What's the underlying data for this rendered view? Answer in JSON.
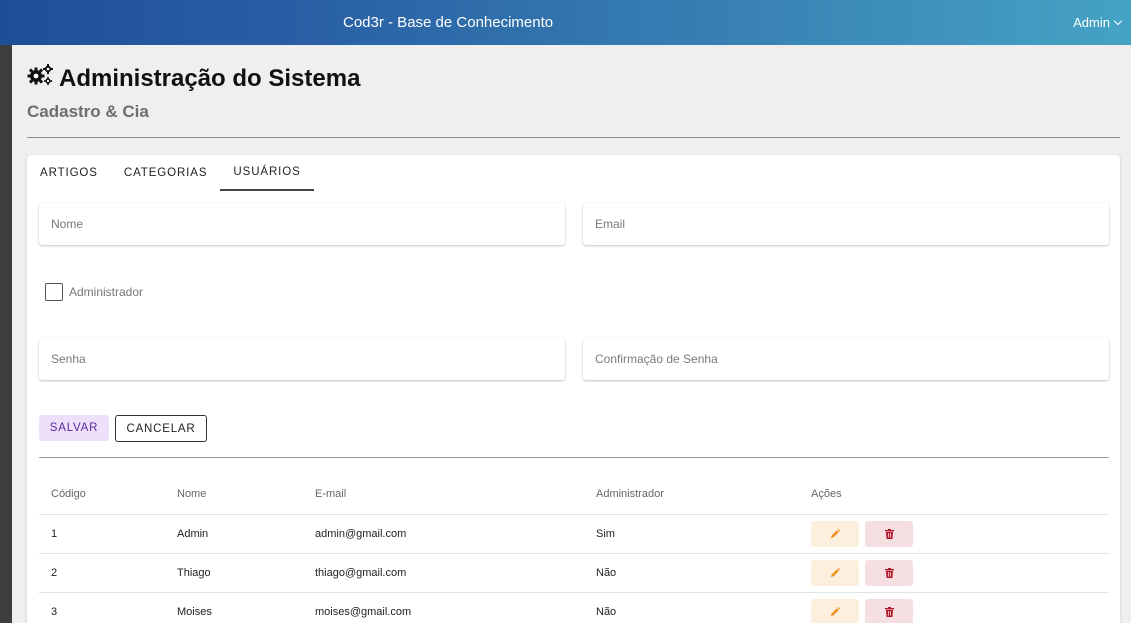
{
  "header": {
    "app_title": "Cod3r - Base de Conhecimento",
    "user_name": "Admin"
  },
  "page": {
    "title": "Administração do Sistema",
    "subtitle": "Cadastro & Cia"
  },
  "tabs": [
    {
      "label": "ARTIGOS"
    },
    {
      "label": "CATEGORIAS"
    },
    {
      "label": "USUÁRIOS"
    }
  ],
  "active_tab": "USUÁRIOS",
  "form": {
    "name_placeholder": "Nome",
    "email_placeholder": "Email",
    "admin_label": "Administrador",
    "password_placeholder": "Senha",
    "confirm_placeholder": "Confirmação de Senha",
    "save_label": "SALVAR",
    "cancel_label": "CANCELAR"
  },
  "table": {
    "headers": [
      "Código",
      "Nome",
      "E-mail",
      "Administrador",
      "Ações"
    ],
    "rows": [
      {
        "id": "1",
        "name": "Admin",
        "email": "admin@gmail.com",
        "admin": "Sim"
      },
      {
        "id": "2",
        "name": "Thiago",
        "email": "thiago@gmail.com",
        "admin": "Não"
      },
      {
        "id": "3",
        "name": "Moises",
        "email": "moises@gmail.com",
        "admin": "Não"
      }
    ]
  },
  "icons": {
    "title_icon": "cogs-icon",
    "edit_icon": "pencil-icon",
    "delete_icon": "trash-icon",
    "user_menu_icon": "chevron-down-icon"
  },
  "colors": {
    "header_start": "#1f4e99",
    "header_end": "#45a3c4",
    "save_bg": "#ede0fb",
    "save_text": "#5a2a9b",
    "edit_bg": "#fdefdd",
    "edit_icon": "#f08c1c",
    "delete_bg": "#f5dfe1",
    "delete_icon": "#b0182a"
  }
}
